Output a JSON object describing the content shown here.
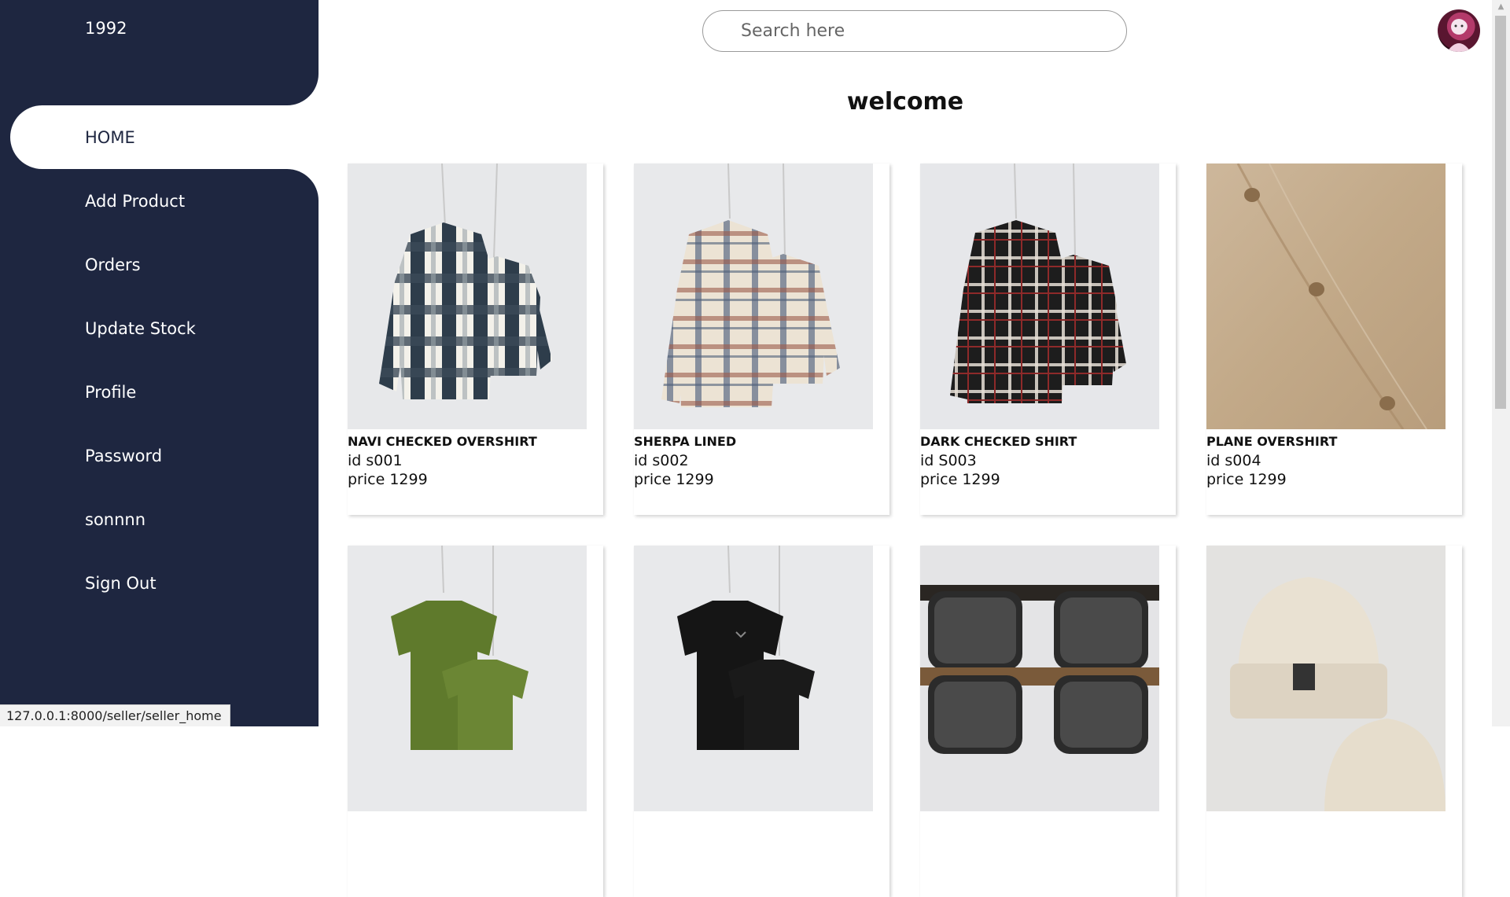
{
  "sidebar": {
    "brand": "1992",
    "items": [
      {
        "label": "HOME",
        "active": true
      },
      {
        "label": "Add Product"
      },
      {
        "label": "Orders"
      },
      {
        "label": "Update Stock"
      },
      {
        "label": "Profile"
      },
      {
        "label": "Password"
      },
      {
        "label": "sonnnn"
      },
      {
        "label": "Sign Out"
      }
    ]
  },
  "header": {
    "search_placeholder": "Search here",
    "avatar_icon": "user-avatar-icon"
  },
  "main": {
    "title": "welcome",
    "products": [
      {
        "name": "NAVI CHECKED OVERSHIRT",
        "id": "id s001",
        "price": "price 1299",
        "image": "navy-white-checked-shirt-pair"
      },
      {
        "name": "SHERPA LINED",
        "id": "id s002",
        "price": "price 1299",
        "image": "beige-plaid-sherpa-shirt-pair"
      },
      {
        "name": "DARK CHECKED SHIRT",
        "id": "id S003",
        "price": "price 1299",
        "image": "black-red-checked-shirt-pair"
      },
      {
        "name": "PLANE OVERSHIRT",
        "id": "id s004",
        "price": "price 1299",
        "image": "tan-corduroy-overshirt"
      },
      {
        "name": "",
        "id": "",
        "price": "",
        "image": "green-tshirt-pair"
      },
      {
        "name": "",
        "id": "",
        "price": "",
        "image": "black-tshirt-pair"
      },
      {
        "name": "",
        "id": "",
        "price": "",
        "image": "black-sunglasses-pair"
      },
      {
        "name": "",
        "id": "",
        "price": "",
        "image": "cream-beanie-pair"
      }
    ]
  },
  "status_bar": {
    "url": "127.0.0.1:8000/seller/seller_home"
  },
  "colors": {
    "sidebar_bg": "#1e2640",
    "active_bg": "#ffffff"
  }
}
